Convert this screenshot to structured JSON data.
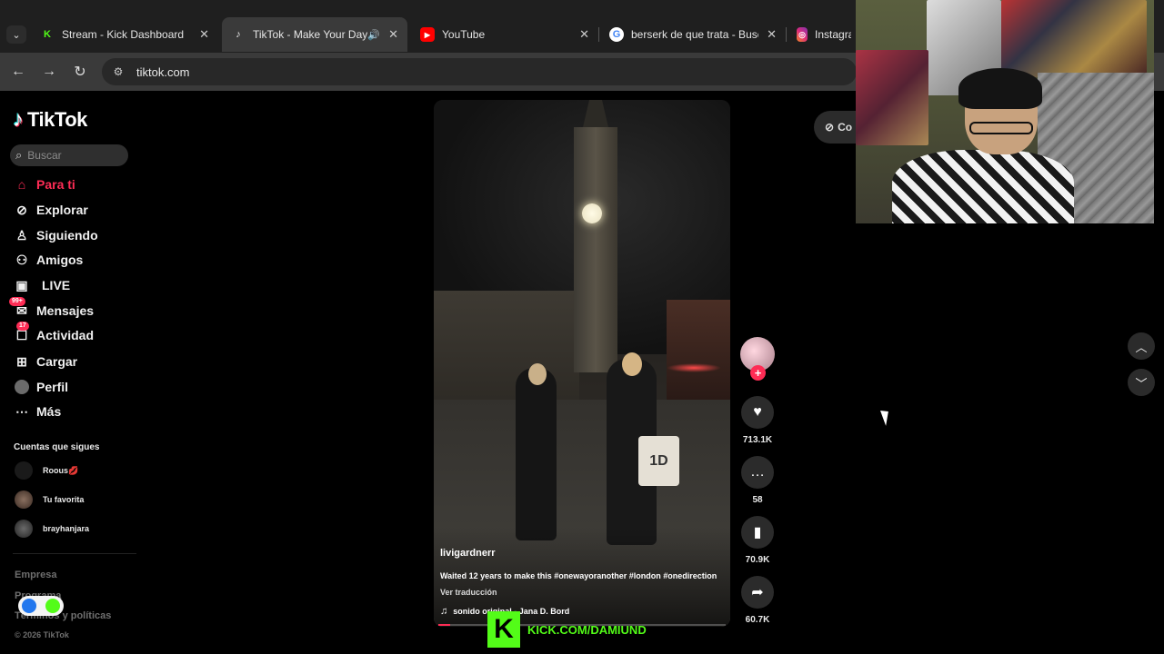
{
  "browser": {
    "tabs": [
      {
        "title": "Stream - Kick Dashboard",
        "favicon": "kick-icon",
        "color": "#53fc18"
      },
      {
        "title": "TikTok - Make Your Day",
        "favicon": "tiktok-icon",
        "active": true
      },
      {
        "title": "YouTube",
        "favicon": "youtube-icon",
        "color": "#ff0000"
      },
      {
        "title": "berserk de que trata - Busca",
        "favicon": "google-icon"
      },
      {
        "title": "Instagram",
        "favicon": "instagram-icon"
      }
    ],
    "address": "tiktok.com"
  },
  "sidebar": {
    "logo": "TikTok",
    "search_placeholder": "Buscar",
    "nav": [
      {
        "label": "Para ti",
        "icon": "home-icon",
        "active": true
      },
      {
        "label": "Explorar",
        "icon": "compass-icon"
      },
      {
        "label": "Siguiendo",
        "icon": "following-icon"
      },
      {
        "label": "Amigos",
        "icon": "friends-icon"
      },
      {
        "label": "LIVE",
        "icon": "live-icon"
      },
      {
        "label": "Mensajes",
        "icon": "messages-icon",
        "badge": "99+"
      },
      {
        "label": "Actividad",
        "icon": "activity-icon",
        "badge": "17"
      },
      {
        "label": "Cargar",
        "icon": "upload-icon"
      },
      {
        "label": "Perfil",
        "icon": "profile-avatar"
      },
      {
        "label": "Más",
        "icon": "more-icon"
      }
    ],
    "following_title": "Cuentas que sigues",
    "following": [
      {
        "name": "Roous💋"
      },
      {
        "name": "Tu favorita"
      },
      {
        "name": "brayhanjara"
      }
    ],
    "footer": [
      "Empresa",
      "Programa",
      "Términos y políticas",
      "© 2026 TikTok"
    ]
  },
  "video": {
    "author": "livigardnerr",
    "caption": "Waited 12 years to make this #onewayoranother #london #onedirection",
    "translate": "Ver traducción",
    "sound": "sonido original - Jana D. Bord",
    "progress": 0.04,
    "bag_text": "1D"
  },
  "actions": {
    "likes": "713.1K",
    "comments": "58",
    "saves": "70.9K",
    "shares": "60.7K"
  },
  "embed_chip": "Co",
  "overlay": {
    "kick_url": "KICK.COM/DAMIUND",
    "kick_logo": "K"
  },
  "colors": {
    "tiktok_accent": "#fe2c55",
    "kick_green": "#53fc18"
  }
}
